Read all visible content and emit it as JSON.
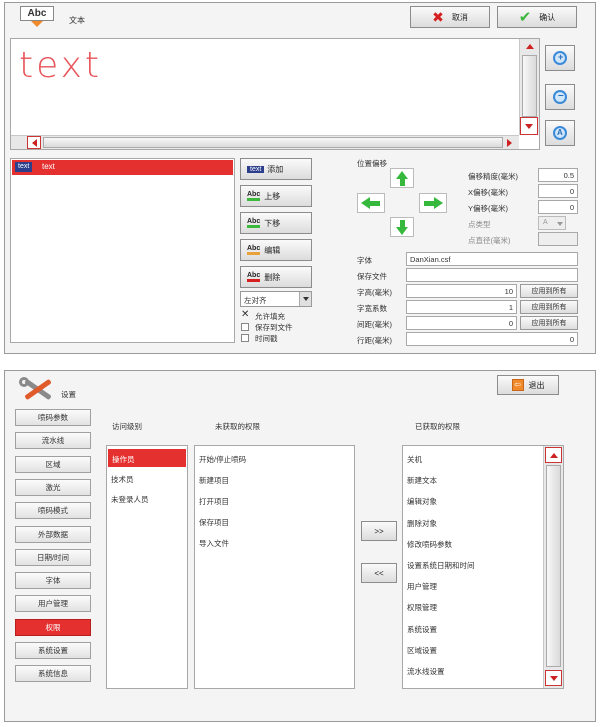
{
  "top": {
    "toolbar": {
      "abc_icon_text": "Abc",
      "title": "文本",
      "cancel_label": "取消",
      "ok_label": "确认"
    },
    "preview_text": "text",
    "list": {
      "items": [
        {
          "badge": "text",
          "label": "text"
        }
      ]
    },
    "actions": {
      "add_badge": "text",
      "add_label": "添加",
      "up_icon": "Abc",
      "up_label": "上移",
      "down_icon": "Abc",
      "down_label": "下移",
      "edit_icon": "Abc",
      "edit_label": "编辑",
      "delete_icon": "Abc",
      "delete_label": "删除",
      "align_value": "左对齐",
      "options": [
        {
          "label": "允许填充",
          "checked": true
        },
        {
          "label": "保存到文件",
          "checked": false
        },
        {
          "label": "时间戳",
          "checked": false
        }
      ]
    },
    "position": {
      "title": "位置偏移",
      "precision_label": "偏移精度(毫米)",
      "precision_value": "0.5",
      "x_label": "X偏移(毫米)",
      "x_value": "0",
      "y_label": "Y偏移(毫米)",
      "y_value": "0",
      "dot_type_label": "点类型",
      "dot_type_value": "A",
      "dot_diameter_label": "点直径(毫米)"
    },
    "font": {
      "font_label": "字体",
      "font_value": "DanXian.csf",
      "savefile_label": "保存文件",
      "savefile_value": "",
      "height_label": "字高(毫米)",
      "height_value": "10",
      "width_label": "字宽系数",
      "width_value": "1",
      "spacing_label": "间距(毫米)",
      "spacing_value": "0",
      "linespacing_label": "行距(毫米)",
      "linespacing_value": "0",
      "apply_all_label": "应用到所有"
    }
  },
  "bottom": {
    "title": "设置",
    "exit_label": "退出",
    "nav": [
      {
        "label": "喷码参数",
        "active": false
      },
      {
        "label": "流水线",
        "active": false
      },
      {
        "label": "区域",
        "active": false
      },
      {
        "label": "激光",
        "active": false
      },
      {
        "label": "喷码模式",
        "active": false
      },
      {
        "label": "外部数据",
        "active": false
      },
      {
        "label": "日期/时间",
        "active": false
      },
      {
        "label": "字体",
        "active": false
      },
      {
        "label": "用户管理",
        "active": false
      },
      {
        "label": "权限",
        "active": true
      },
      {
        "label": "系统设置",
        "active": false
      },
      {
        "label": "系统信息",
        "active": false
      }
    ],
    "access_level_header": "访问级别",
    "unobtained_header": "未获取的权限",
    "obtained_header": "已获取的权限",
    "levels": [
      {
        "label": "操作员",
        "selected": true
      },
      {
        "label": "技术员",
        "selected": false
      },
      {
        "label": "未登录人员",
        "selected": false
      }
    ],
    "unobtained": [
      "开始/停止喷码",
      "新建项目",
      "打开项目",
      "保存项目",
      "导入文件"
    ],
    "obtained": [
      "关机",
      "新建文本",
      "编辑对象",
      "删除对象",
      "修改喷码参数",
      "设置系统日期和时间",
      "用户管理",
      "权限管理",
      "系统设置",
      "区域设置",
      "流水线设置",
      "激光设置"
    ],
    "add_arrow": ">>",
    "remove_arrow": "<<"
  },
  "colors": {
    "accent_red": "#e53030",
    "selection_red": "#e53030",
    "preview_text": "#e8555a",
    "arrow_green": "#36b83c"
  }
}
